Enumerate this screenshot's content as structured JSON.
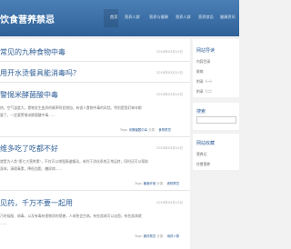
{
  "site": {
    "title": "饮食营养禁忌"
  },
  "nav": {
    "items": [
      "首页",
      "营养人群",
      "营养与健康",
      "营养人群",
      "营养禁忌",
      "健康资讯"
    ]
  },
  "posts": [
    {
      "title": "常见的九种食物中毒",
      "date": "2018年03月10日"
    },
    {
      "title": "用开水烫餐具能消毒吗？",
      "date": "2018年03月10日"
    },
    {
      "title": "警惕米酵菌酸中毒",
      "date": "2018年03月10日",
      "excerpt1": "热，空气湿度大，食物发生变质的概率明显增加，有很人食物中毒的风险。特别是我们每年都",
      "excerpt2": "要了，一定要警惕米酵菌酸中毒……",
      "tags_label": "Tags:",
      "tag": "米酵菌酸中毒",
      "category_label": "分类：",
      "category": "食物禁忌"
    },
    {
      "title": "维多吃了吃都不好",
      "date": "2018年03月10日",
      "excerpt1": "就是为人类\"第七大营养素\"，不仅可以增强肠道蠕动，有利于消化系统正常运转，同时还可以帮助",
      "excerpt2": "身体，清理毒素，降低血脂、糖尿病……",
      "tags_label": "Tags:",
      "tag": "膳食纤维",
      "category_label": "分类：",
      "category": "食物禁忌"
    },
    {
      "title": "见药，千万不要一起用",
      "date": "2018年03月10日",
      "excerpt1": "乃时候服、病毒，以及有毒有害物质的侵袭，人体免会生病。有些疾病可以自愈，有些疾病就",
      "excerpt2": "……",
      "tags_label": "Tags:",
      "tag": "服药禁忌",
      "category_label": "分类：",
      "category": "用药人群"
    }
  ],
  "sidebar": {
    "nav_title": "网站导读",
    "nav_links": [
      "内容目录",
      "联络",
      "附录（一）",
      "附录（二）"
    ],
    "search_title": "搜索",
    "collect_title": "网站收藏",
    "collect_links": [
      "营养记",
      "饮食营养"
    ]
  }
}
